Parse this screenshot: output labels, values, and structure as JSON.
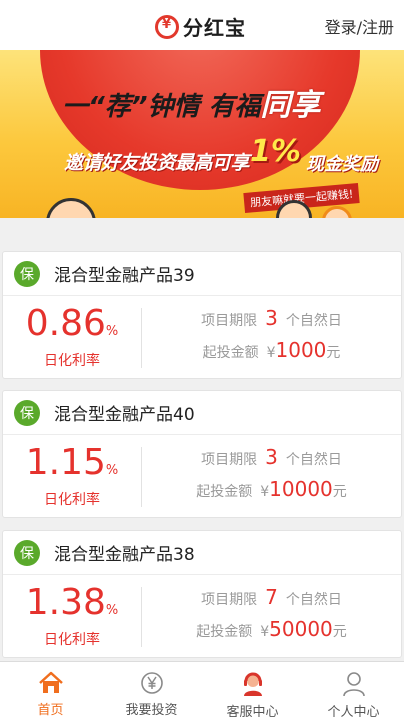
{
  "header": {
    "logo_text": "分红宝",
    "login_label": "登录/注册"
  },
  "banner": {
    "line1_a": "一“荐”钟情 有福",
    "line1_b": "同享",
    "line2": "邀请好友投资最高可享",
    "percent": "1%",
    "reward": "现金奖励",
    "sub": "朋友嘛就要一起赚钱!"
  },
  "products": [
    {
      "title": "混合型金融产品39",
      "badge": "保",
      "rate": "0.86",
      "rate_unit": "%",
      "rate_label": "日化利率",
      "term_label": "项目期限",
      "term_value": "3",
      "term_unit": "个自然日",
      "min_label": "起投金额",
      "currency": "¥",
      "min_value": "1000",
      "min_unit": "元"
    },
    {
      "title": "混合型金融产品40",
      "badge": "保",
      "rate": "1.15",
      "rate_unit": "%",
      "rate_label": "日化利率",
      "term_label": "项目期限",
      "term_value": "3",
      "term_unit": "个自然日",
      "min_label": "起投金额",
      "currency": "¥",
      "min_value": "10000",
      "min_unit": "元"
    },
    {
      "title": "混合型金融产品38",
      "badge": "保",
      "rate": "1.38",
      "rate_unit": "%",
      "rate_label": "日化利率",
      "term_label": "项目期限",
      "term_value": "7",
      "term_unit": "个自然日",
      "min_label": "起投金额",
      "currency": "¥",
      "min_value": "50000",
      "min_unit": "元"
    }
  ],
  "tabbar": {
    "items": [
      {
        "label": "首页",
        "icon": "home-icon",
        "active": true
      },
      {
        "label": "我要投资",
        "icon": "yen-coin-icon",
        "active": false
      },
      {
        "label": "客服中心",
        "icon": "customer-service-icon",
        "active": false
      },
      {
        "label": "个人中心",
        "icon": "user-icon",
        "active": false
      }
    ]
  },
  "colors": {
    "accent_red": "#e5322d",
    "badge_green": "#5aa92b",
    "tab_active": "#f06e1e"
  }
}
